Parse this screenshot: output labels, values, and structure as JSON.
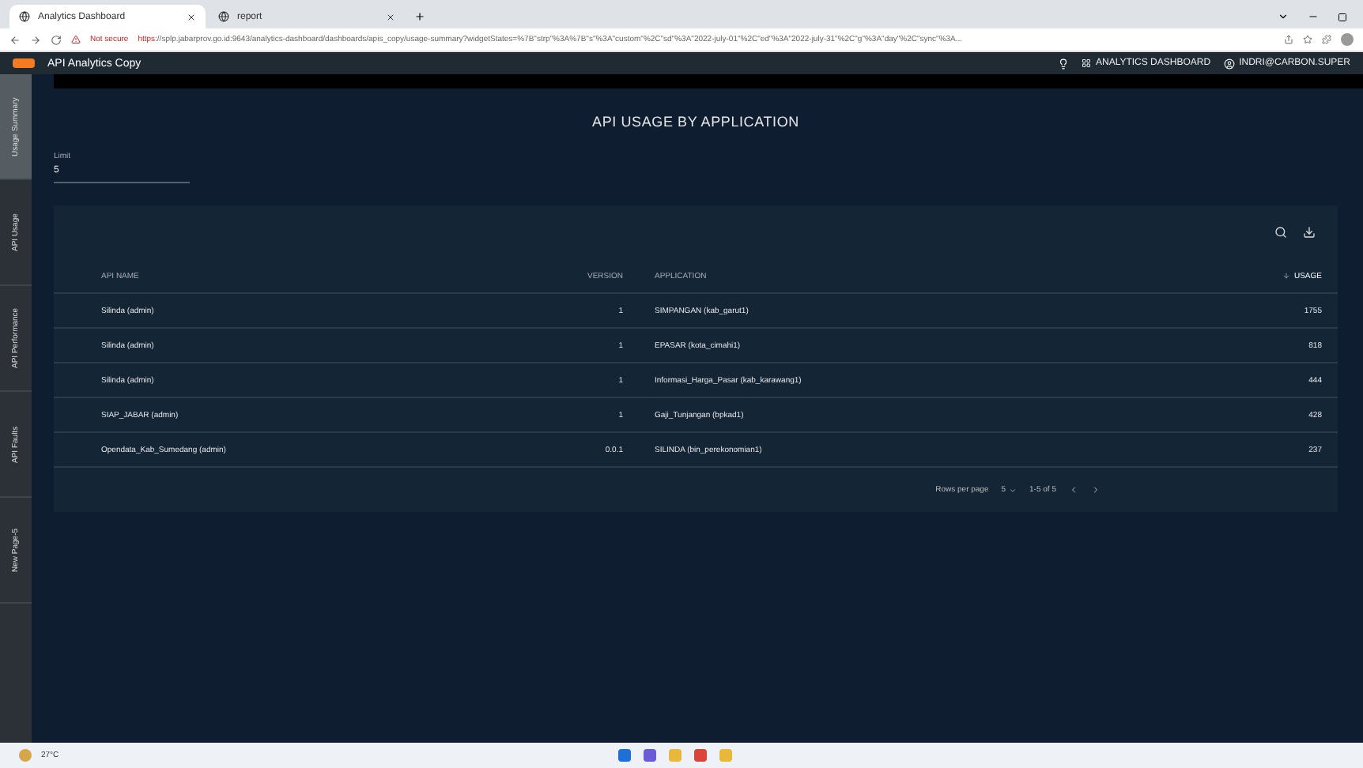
{
  "browser": {
    "tabs": [
      {
        "title": "Analytics Dashboard",
        "selected": true
      },
      {
        "title": "report",
        "selected": false
      }
    ],
    "security": "Not secure",
    "url_scheme": "https",
    "url": "://splp.jabarprov.go.id:9643/analytics-dashboard/dashboards/apis_copy/usage-summary?widgetStates=%7B\"strp\"%3A%7B\"s\"%3A\"custom\"%2C\"sd\"%3A\"2022-july-01\"%2C\"ed\"%3A\"2022-july-31\"%2C\"g\"%3A\"day\"%2C\"sync\"%3A..."
  },
  "app": {
    "title": "API Analytics Copy",
    "dashboard_link": "ANALYTICS DASHBOARD",
    "user": "INDRI@CARBON.SUPER"
  },
  "sidebar": {
    "items": [
      {
        "label": "Usage Summary",
        "selected": true
      },
      {
        "label": "API Usage",
        "selected": false
      },
      {
        "label": "API Performance",
        "selected": false
      },
      {
        "label": "API Faults",
        "selected": false
      },
      {
        "label": "New Page-5",
        "selected": false
      }
    ]
  },
  "widget": {
    "title": "API USAGE BY APPLICATION",
    "limit": {
      "label": "Limit",
      "value": "5"
    },
    "table": {
      "columns": [
        {
          "label": "API NAME",
          "kind": "text",
          "sorted": false
        },
        {
          "label": "VERSION",
          "kind": "number",
          "sorted": false
        },
        {
          "label": "APPLICATION",
          "kind": "text",
          "sorted": false
        },
        {
          "label": "USAGE",
          "kind": "number",
          "sorted": true
        }
      ],
      "rows": [
        [
          "Silinda (admin)",
          "1",
          "SIMPANGAN (kab_garut1)",
          "1755"
        ],
        [
          "Silinda (admin)",
          "1",
          "EPASAR (kota_cimahi1)",
          "818"
        ],
        [
          "Silinda (admin)",
          "1",
          "Informasi_Harga_Pasar (kab_karawang1)",
          "444"
        ],
        [
          "SIAP_JABAR (admin)",
          "1",
          "Gaji_Tunjangan (bpkad1)",
          "428"
        ],
        [
          "Opendata_Kab_Sumedang (admin)",
          "0.0.1",
          "SILINDA (bin_perekonomian1)",
          "237"
        ]
      ],
      "rows_per_page_label": "Rows per page",
      "rows_per_page": "5",
      "range": "1-5 of 5"
    }
  },
  "taskbar": {
    "temperature": "27°C"
  }
}
